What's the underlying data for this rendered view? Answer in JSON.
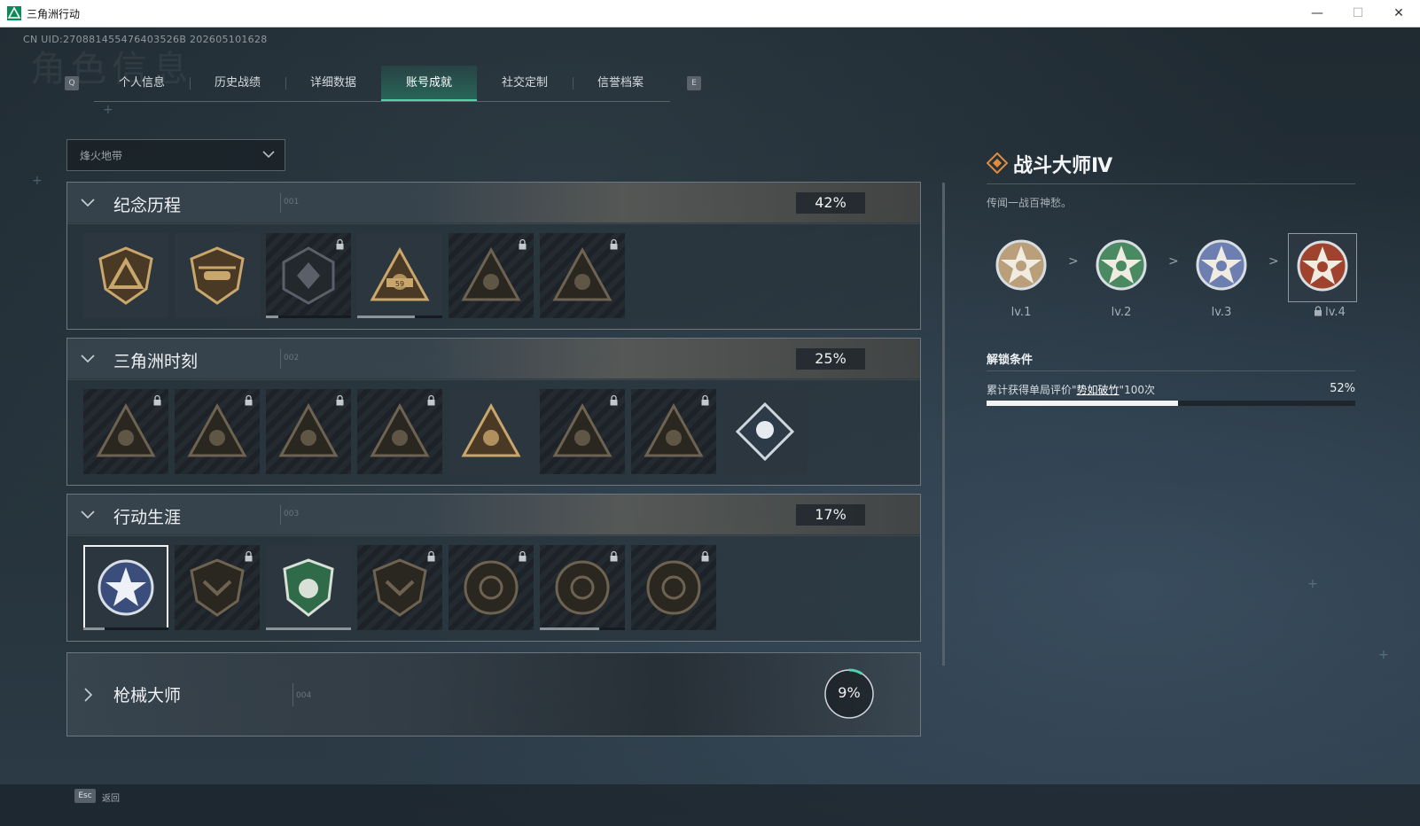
{
  "window": {
    "title": "三角洲行动",
    "minimize": "—",
    "maximize": "☐",
    "close": "✕"
  },
  "uid": "CN UID:270881455476403526B 202605101628",
  "background_title": "角色信息",
  "tabs": {
    "left_key": "Q",
    "right_key": "E",
    "items": [
      {
        "label": "个人信息"
      },
      {
        "label": "历史战绩"
      },
      {
        "label": "详细数据"
      },
      {
        "label": "账号成就",
        "active": true
      },
      {
        "label": "社交定制"
      },
      {
        "label": "信誉档案"
      }
    ]
  },
  "mode_dropdown": {
    "value": "烽火地带"
  },
  "sections": [
    {
      "label": "纪念历程",
      "code": "001",
      "percent": "42%",
      "badges": [
        {
          "icon": "triangle-shield",
          "locked": false,
          "progress": 0
        },
        {
          "icon": "helicopter-shield",
          "locked": false,
          "progress": 0
        },
        {
          "icon": "hex-crest",
          "locked": true,
          "progress": 0.15
        },
        {
          "icon": "tank-winged-59",
          "locked": false,
          "progress": 0.68
        },
        {
          "icon": "soldier-triangle",
          "locked": true,
          "progress": 0
        },
        {
          "icon": "skull-crossed",
          "locked": true,
          "progress": 0
        }
      ]
    },
    {
      "label": "三角洲时刻",
      "code": "002",
      "percent": "25%",
      "badges": [
        {
          "icon": "box-triangle",
          "locked": true
        },
        {
          "icon": "figure-triangle",
          "locked": true
        },
        {
          "icon": "runner-triangle",
          "locked": true
        },
        {
          "icon": "head-triangle",
          "locked": true
        },
        {
          "icon": "team-triangle",
          "locked": false
        },
        {
          "icon": "beast-triangle",
          "locked": true
        },
        {
          "icon": "fish-triangle",
          "locked": true
        },
        {
          "icon": "fist-diamond",
          "locked": false
        }
      ]
    },
    {
      "label": "行动生涯",
      "code": "003",
      "percent": "17%",
      "badges": [
        {
          "icon": "star-wreath-blue",
          "locked": false,
          "selected": true,
          "progress": 0.25
        },
        {
          "icon": "chevron-shield",
          "locked": true
        },
        {
          "icon": "green-shield",
          "locked": false,
          "progress": 1.0
        },
        {
          "icon": "d20-shield",
          "locked": true
        },
        {
          "icon": "ring-emblem",
          "locked": true
        },
        {
          "icon": "target-emblem",
          "locked": true,
          "progress": 0.7
        },
        {
          "icon": "eye-emblem",
          "locked": true
        }
      ]
    }
  ],
  "gun_master": {
    "label": "枪械大师",
    "code": "004",
    "percent": "9%",
    "value": 0.09
  },
  "detail": {
    "title": "战斗大师Ⅳ",
    "description": "传闻一战百神愁。",
    "levels": [
      {
        "label": "lv.1",
        "color": "#b9a07a",
        "locked": false
      },
      {
        "label": "lv.2",
        "color": "#4a8a62",
        "locked": false
      },
      {
        "label": "lv.3",
        "color": "#6c7fb0",
        "locked": false
      },
      {
        "label": "lv.4",
        "color": "#a0432e",
        "locked": true,
        "current": true
      }
    ],
    "arrow": ">",
    "unlock_title": "解锁条件",
    "condition_prefix": "累计获得单局评价\"",
    "condition_highlight": "势如破竹",
    "condition_suffix": "\"100次",
    "condition_percent": "52%",
    "condition_value": 0.52
  },
  "footer": {
    "esc_key": "Esc",
    "back_label": "返回"
  },
  "colors": {
    "accent": "#4fd3a8",
    "badge_gold": "#c9a66b"
  }
}
